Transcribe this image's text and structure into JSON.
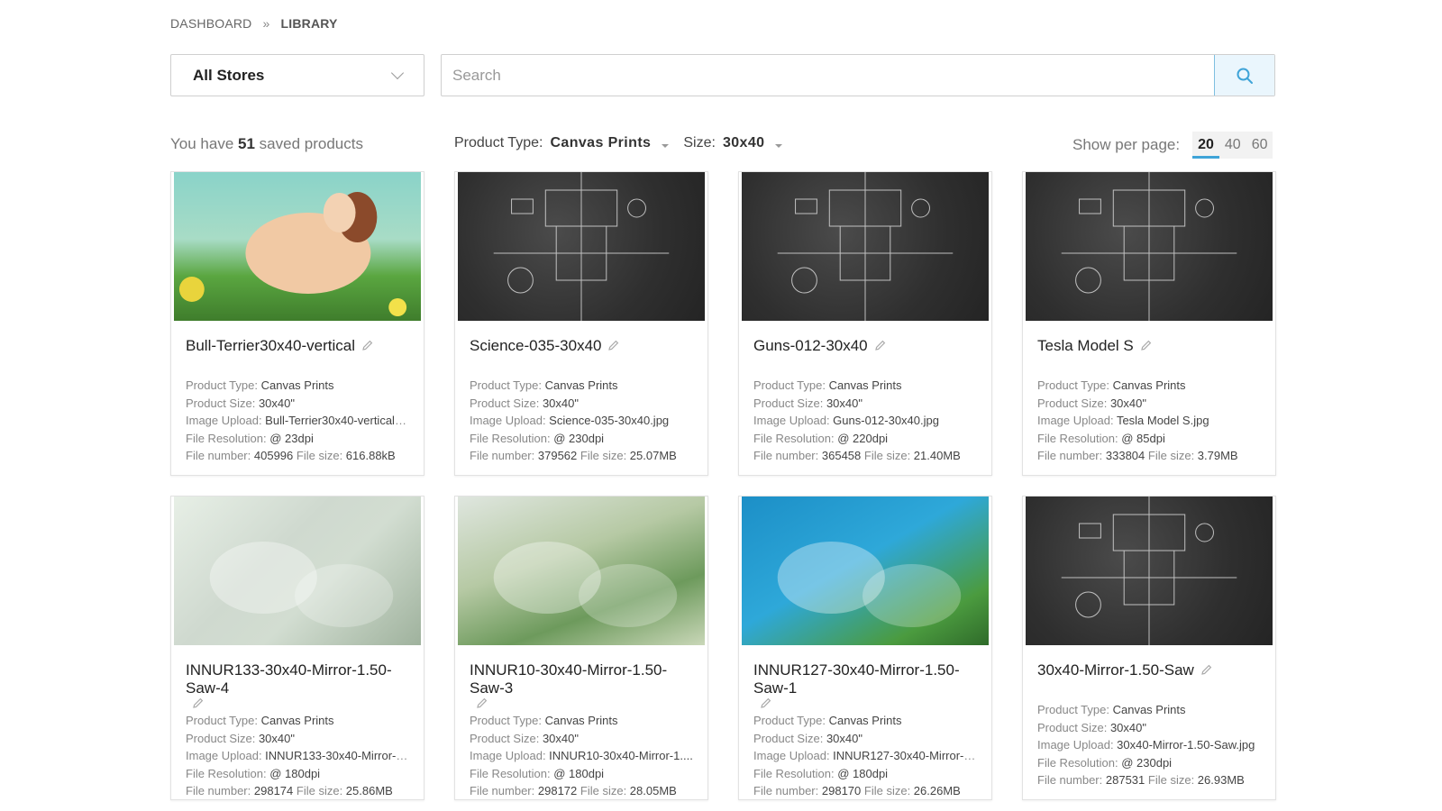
{
  "breadcrumb": {
    "root": "DASHBOARD",
    "separator": "»",
    "current": "LIBRARY"
  },
  "store_select": {
    "value": "All Stores"
  },
  "search": {
    "placeholder": "Search"
  },
  "summary": {
    "prefix": "You have",
    "count": "51",
    "suffix": "saved products"
  },
  "filters": {
    "product_type_label": "Product Type:",
    "product_type_value": "Canvas Prints",
    "size_label": "Size:",
    "size_value": "30x40"
  },
  "per_page": {
    "label": "Show per page:",
    "options": [
      "20",
      "40",
      "60"
    ],
    "selected": "20"
  },
  "detail_labels": {
    "type": "Product Type: ",
    "size": "Product Size: ",
    "upload": "Image Upload: ",
    "resolution": "File Resolution: ",
    "number": "File number: ",
    "filesize": "File size: "
  },
  "products": [
    {
      "name": "Bull-Terrier30x40-vertical",
      "type": "Canvas Prints",
      "size": "30x40\"",
      "upload": "Bull-Terrier30x40-vertical.j...",
      "resolution": "@ 23dpi",
      "number": "405996",
      "filesize": "616.88kB",
      "thumb": "art-dog"
    },
    {
      "name": "Science-035-30x40",
      "type": "Canvas Prints",
      "size": "30x40\"",
      "upload": "Science-035-30x40.jpg",
      "resolution": "@ 230dpi",
      "number": "379562",
      "filesize": "25.07MB",
      "thumb": "chalk"
    },
    {
      "name": "Guns-012-30x40",
      "type": "Canvas Prints",
      "size": "30x40\"",
      "upload": "Guns-012-30x40.jpg",
      "resolution": "@ 220dpi",
      "number": "365458",
      "filesize": "21.40MB",
      "thumb": "chalk"
    },
    {
      "name": "Tesla Model S",
      "type": "Canvas Prints",
      "size": "30x40\"",
      "upload": "Tesla Model S.jpg",
      "resolution": "@ 85dpi",
      "number": "333804",
      "filesize": "3.79MB",
      "thumb": "chalk"
    },
    {
      "name": "INNUR133-30x40-Mirror-1.50-Saw-4",
      "type": "Canvas Prints",
      "size": "30x40\"",
      "upload": "INNUR133-30x40-Mirror-1...",
      "resolution": "@ 180dpi",
      "number": "298174",
      "filesize": "25.86MB",
      "thumb": "art-care"
    },
    {
      "name": "INNUR10-30x40-Mirror-1.50-Saw-3",
      "type": "Canvas Prints",
      "size": "30x40\"",
      "upload": "INNUR10-30x40-Mirror-1....",
      "resolution": "@ 180dpi",
      "number": "298172",
      "filesize": "28.05MB",
      "thumb": "art-nurse"
    },
    {
      "name": "INNUR127-30x40-Mirror-1.50-Saw-1",
      "type": "Canvas Prints",
      "size": "30x40\"",
      "upload": "INNUR127-30x40-Mirror-1...",
      "resolution": "@ 180dpi",
      "number": "298170",
      "filesize": "26.26MB",
      "thumb": "art-blue"
    },
    {
      "name": "30x40-Mirror-1.50-Saw",
      "type": "Canvas Prints",
      "size": "30x40\"",
      "upload": "30x40-Mirror-1.50-Saw.jpg",
      "resolution": "@ 230dpi",
      "number": "287531",
      "filesize": "26.93MB",
      "thumb": "chalk"
    }
  ],
  "colors": {
    "accent": "#3fa4d8",
    "search_button_bg": "#eaf6fd"
  }
}
